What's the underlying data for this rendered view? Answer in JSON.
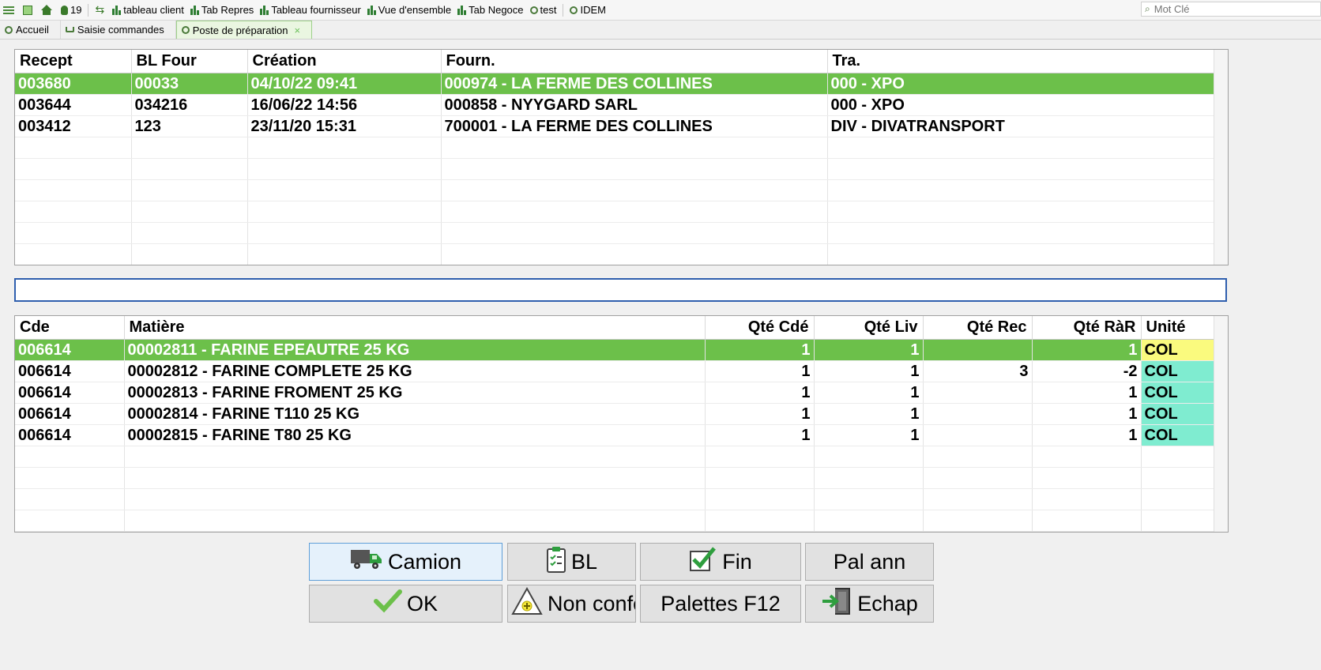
{
  "toolbar": {
    "count": "19",
    "items": [
      "tableau client",
      "Tab Repres",
      "Tableau fournisseur",
      "Vue d'ensemble",
      "Tab Negoce",
      "test",
      "IDEM"
    ],
    "search_placeholder": "Mot Clé"
  },
  "tabs": [
    {
      "label": "Accueil"
    },
    {
      "label": "Saisie commandes"
    },
    {
      "label": "Poste de préparation",
      "close": "×"
    }
  ],
  "receptions": {
    "columns": [
      "Recept",
      "BL Four",
      "Création",
      "Fourn.",
      "Tra."
    ],
    "rows": [
      [
        "003680",
        "00033",
        "04/10/22 09:41",
        "000974 - LA FERME DES COLLINES",
        "000 - XPO"
      ],
      [
        "003644",
        "034216",
        "16/06/22 14:56",
        "000858 - NYYGARD SARL",
        "000 - XPO"
      ],
      [
        "003412",
        "123",
        "23/11/20 15:31",
        "700001 - LA FERME DES COLLINES",
        "DIV - DIVATRANSPORT"
      ]
    ],
    "selected_row": 0
  },
  "scan_input": {
    "value": ""
  },
  "lines": {
    "columns": [
      "Cde",
      "Matière",
      "Qté Cdé",
      "Qté Liv",
      "Qté Rec",
      "Qté RàR",
      "Unité"
    ],
    "rows": [
      [
        "006614",
        "00002811 - FARINE EPEAUTRE 25 KG",
        "1",
        "1",
        "",
        "1",
        "COL"
      ],
      [
        "006614",
        "00002812 - FARINE COMPLETE 25 KG",
        "1",
        "1",
        "3",
        "-2",
        "COL"
      ],
      [
        "006614",
        "00002813 - FARINE FROMENT 25 KG",
        "1",
        "1",
        "",
        "1",
        "COL"
      ],
      [
        "006614",
        "00002814 - FARINE T110 25 KG",
        "1",
        "1",
        "",
        "1",
        "COL"
      ],
      [
        "006614",
        "00002815 - FARINE T80 25 KG",
        "1",
        "1",
        "",
        "1",
        "COL"
      ]
    ],
    "selected_row": 0
  },
  "buttons": {
    "camion": "Camion",
    "bl": "BL",
    "fin": "Fin",
    "pal_ann": "Pal ann",
    "ok": "OK",
    "non_conf": "Non confo",
    "palettes": "Palettes F12",
    "echap": "Echap"
  },
  "colors": {
    "selection": "#6cc04a",
    "unit_highlight": "#fafa7e",
    "unit_cell": "#7fecd0",
    "focus_border": "#2f5fae"
  }
}
